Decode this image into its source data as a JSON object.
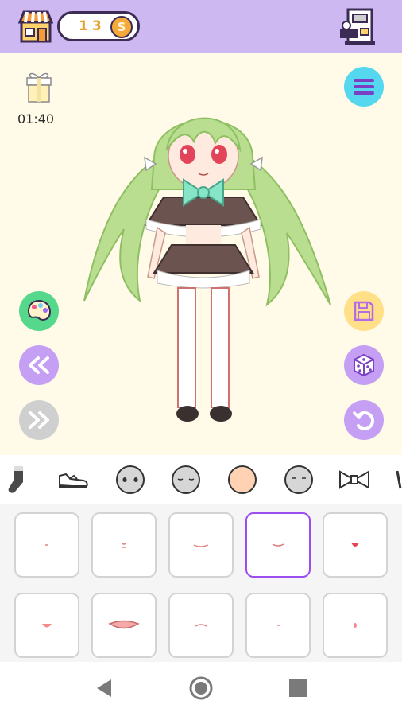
{
  "topbar": {
    "coins": "13",
    "coin_symbol": "S",
    "bg_color": "#cdb8f2"
  },
  "stage": {
    "timer": "01:40",
    "bg_color": "#fffbe8"
  },
  "left_buttons": [
    "palette-icon",
    "rewind-icon",
    "fast-forward-icon"
  ],
  "right_buttons": [
    "menu-icon",
    "save-icon",
    "dice-icon",
    "undo-icon"
  ],
  "categories": [
    {
      "name": "socks",
      "icon": "sock-icon"
    },
    {
      "name": "shoes",
      "icon": "shoe-icon"
    },
    {
      "name": "face-1",
      "icon": "face-icon"
    },
    {
      "name": "face-2",
      "icon": "face-sleepy-icon"
    },
    {
      "name": "mouth",
      "icon": "face-skin-icon",
      "selected": true
    },
    {
      "name": "face-3",
      "icon": "face-icon"
    },
    {
      "name": "bow",
      "icon": "bow-icon"
    }
  ],
  "mouth_options": {
    "selected_index": 3,
    "count": 10
  },
  "nav": [
    "back-icon",
    "home-icon",
    "recents-icon"
  ]
}
